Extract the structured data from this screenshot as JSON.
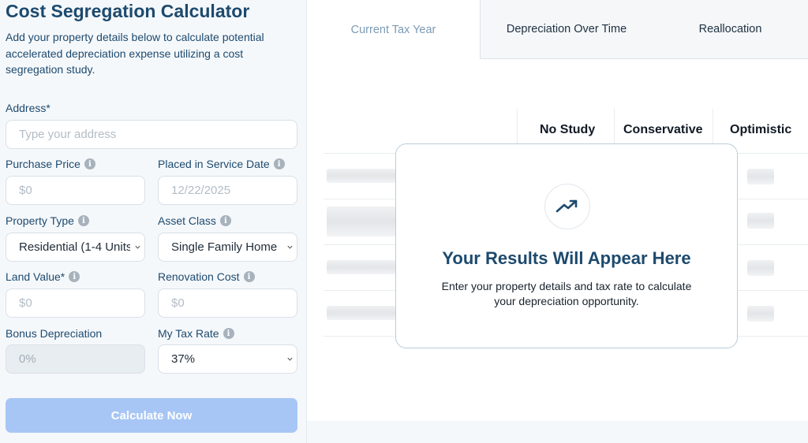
{
  "calculator": {
    "title": "Cost Segregation Calculator",
    "description": "Add your property details below to calculate potential accelerated depreciation expense utilizing a cost segregation study."
  },
  "form": {
    "address": {
      "label": "Address*",
      "placeholder": "Type your address"
    },
    "purchase_price": {
      "label": "Purchase Price",
      "placeholder": "$0"
    },
    "placed_in_service": {
      "label": "Placed in Service Date",
      "placeholder": "12/22/2025"
    },
    "property_type": {
      "label": "Property Type",
      "value": "Residential (1-4 Units)"
    },
    "asset_class": {
      "label": "Asset Class",
      "value": "Single Family Home"
    },
    "land_value": {
      "label": "Land Value*",
      "placeholder": "$0"
    },
    "renovation_cost": {
      "label": "Renovation Cost",
      "placeholder": "$0"
    },
    "bonus_depreciation": {
      "label": "Bonus Depreciation",
      "value": "0%"
    },
    "tax_rate": {
      "label": "My Tax Rate",
      "value": "37%"
    },
    "calculate_label": "Calculate Now"
  },
  "tabs": [
    {
      "label": "Current Tax Year"
    },
    {
      "label": "Depreciation Over Time"
    },
    {
      "label": "Reallocation"
    }
  ],
  "results_table": {
    "columns": [
      "No Study",
      "Conservative",
      "Optimistic"
    ]
  },
  "placeholder_card": {
    "title": "Your Results Will Appear Here",
    "subtitle": "Enter your property details and tax rate to calculate your depreciation opportunity.",
    "icon": "trending-up-icon"
  },
  "colors": {
    "brand": "#1d4a6e",
    "button": "#a7c6f5",
    "panel_bg": "#f5f8fb"
  }
}
